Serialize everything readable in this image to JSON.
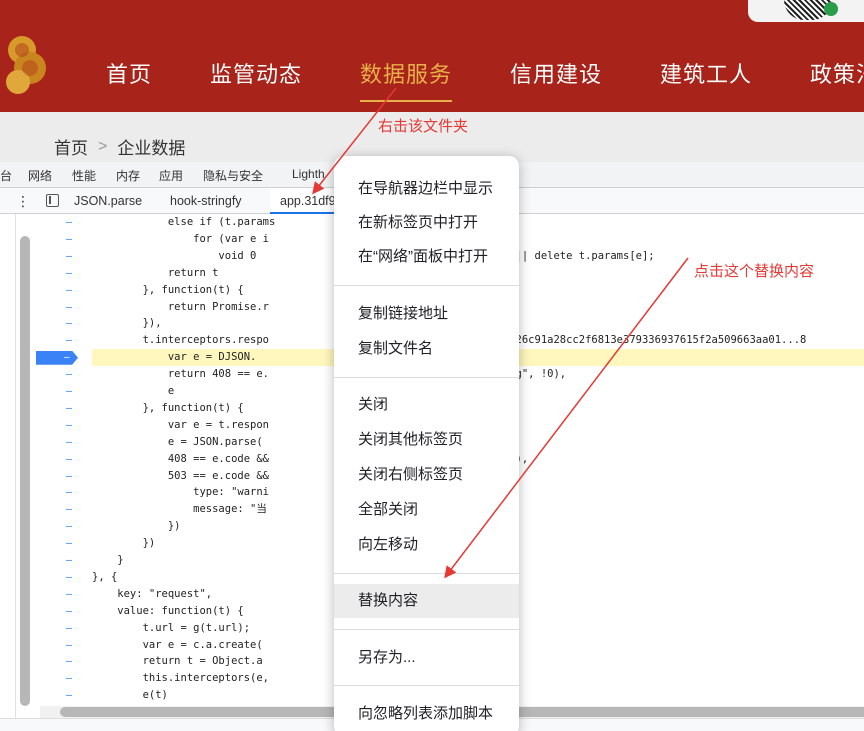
{
  "site": {
    "nav": [
      "首页",
      "监管动态",
      "数据服务",
      "信用建设",
      "建筑工人",
      "政策法"
    ],
    "active_index": 2,
    "breadcrumb": [
      "首页",
      "企业数据"
    ],
    "colors": {
      "header_bg": "#a8231a",
      "nav_active": "#e8b04a"
    }
  },
  "devtools": {
    "top_tabs": [
      "台",
      "网络",
      "性能",
      "内存",
      "应用",
      "隐私与安全",
      "Lighth"
    ],
    "file_tabs": [
      "JSON.parse",
      "hook-stringfy",
      "app.31df9"
    ],
    "active_file_tab": 2,
    "code_lines": [
      "            else if (t.params",
      "                for (var e i",
      "                    void 0                                  ams[e] || delete t.params[e];",
      "            return t",
      "        }, function(t) {",
      "            return Promise.r",
      "        }),",
      "        t.interceptors.respo                          ta: '5588a9e126c91a28cc2f6813e379336937615f2a509663aa01...8",
      "            var e = DJSON.",
      "            return 408 == e.                              tchaDilaog\", !0),",
      "            e",
      "        }, function(t) {",
      "            var e = t.respon",
      "            e = JSON.parse(",
      "            408 == e.code &&                               aog\", !0),",
      "            503 == e.code &&",
      "                type: \"warni",
      "                message: \"当",
      "            })",
      "        })",
      "    }",
      "}, {",
      "    key: \"request\",",
      "    value: function(t) {",
      "        t.url = g(t.url);",
      "        var e = c.a.create(",
      "        return t = Object.a                                ),",
      "        this.interceptors(e,",
      "        e(t)"
    ],
    "highlight_line": 8
  },
  "context_menu": {
    "items": [
      "在导航器边栏中显示",
      "在新标签页中打开",
      "在“网络”面板中打开",
      "复制链接地址",
      "复制文件名",
      "关闭",
      "关闭其他标签页",
      "关闭右侧标签页",
      "全部关闭",
      "向左移动",
      "替换内容",
      "另存为...",
      "向忽略列表添加脚本"
    ],
    "highlighted": "替换内容"
  },
  "annotations": {
    "a1": "右击该文件夹",
    "a2": "点击这个替换内容",
    "color": "#e53935"
  }
}
